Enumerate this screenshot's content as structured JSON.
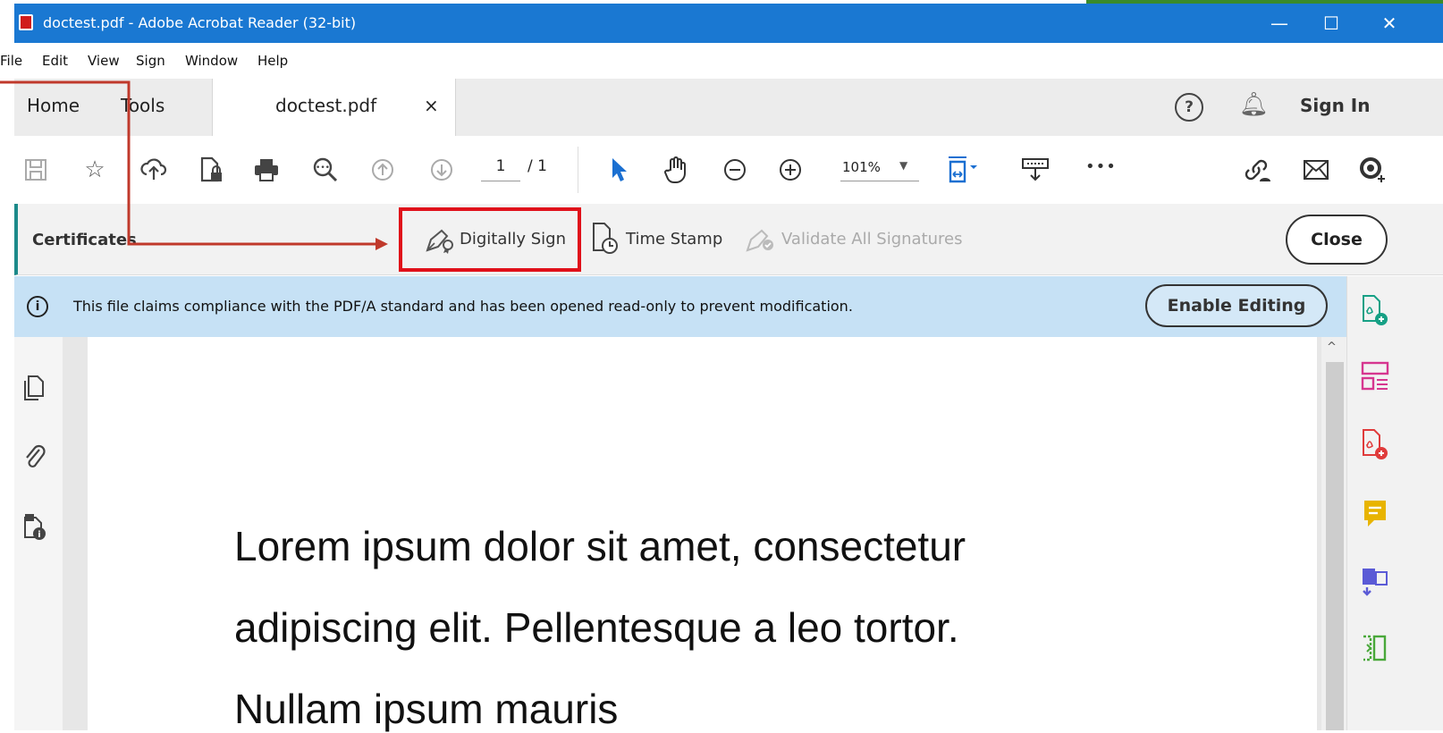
{
  "window": {
    "title": "doctest.pdf - Adobe Acrobat Reader (32-bit)",
    "minimize": "—",
    "maximize": "☐",
    "close": "✕"
  },
  "menu": [
    "File",
    "Edit",
    "View",
    "Sign",
    "Window",
    "Help"
  ],
  "tabs": {
    "home": "Home",
    "tools": "Tools",
    "document": "doctest.pdf",
    "close_tab": "×",
    "sign_in": "Sign In"
  },
  "toolbar": {
    "page_current": "1",
    "page_total": "/ 1",
    "zoom": "101%",
    "more": "•••"
  },
  "certificates": {
    "label": "Certificates",
    "digitally_sign": "Digitally Sign",
    "time_stamp": "Time Stamp",
    "validate_all": "Validate All Signatures",
    "close": "Close"
  },
  "infobar": {
    "message": "This file claims compliance with the PDF/A standard and has been opened read-only to prevent modification.",
    "enable_editing": "Enable Editing"
  },
  "document": {
    "lines": [
      "Lorem ipsum dolor sit amet, consectetur",
      "adipiscing elit. Pellentesque a leo tortor.",
      "Nullam ipsum mauris"
    ]
  },
  "colors": {
    "titlebar": "#1a78d2",
    "highlight": "#e0101a",
    "arrow": "#c0392b",
    "infobar": "#c6e1f5"
  }
}
